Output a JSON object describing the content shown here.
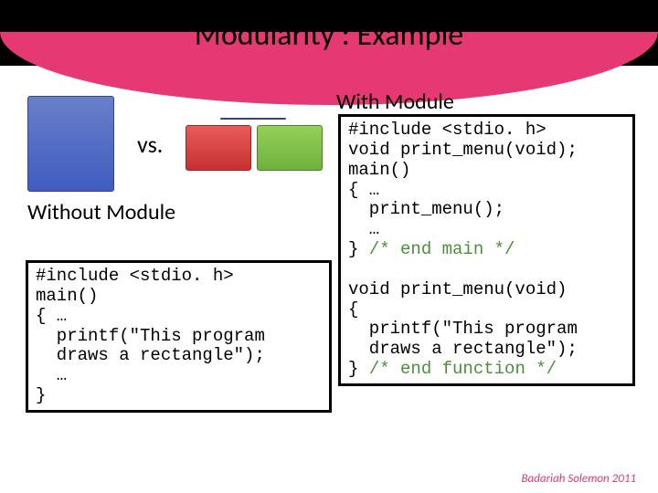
{
  "title": "Modularity : Example",
  "labels": {
    "with": "With Module",
    "without": "Without Module",
    "vs": "vs."
  },
  "code": {
    "without": {
      "l1": "#include <stdio. h>",
      "l2": "main()",
      "l3": "{ …",
      "l4": "  printf(\"This program",
      "l5": "  draws a rectangle\");",
      "l6": "  …",
      "l7": "}"
    },
    "with": {
      "l1": "#include <stdio. h>",
      "l2": "void print_menu(void);",
      "l3": "main()",
      "l4": "{ …",
      "l5": "  print_menu();",
      "l6": "  …",
      "l7a": "} ",
      "l7b": "/* end main */",
      "l8": "",
      "l9": "void print_menu(void)",
      "l10": "{",
      "l11": "  printf(\"This program",
      "l12": "  draws a rectangle\");",
      "l13a": "} ",
      "l13b": "/* end function */"
    }
  },
  "footer": "Badariah Solemon 2011"
}
